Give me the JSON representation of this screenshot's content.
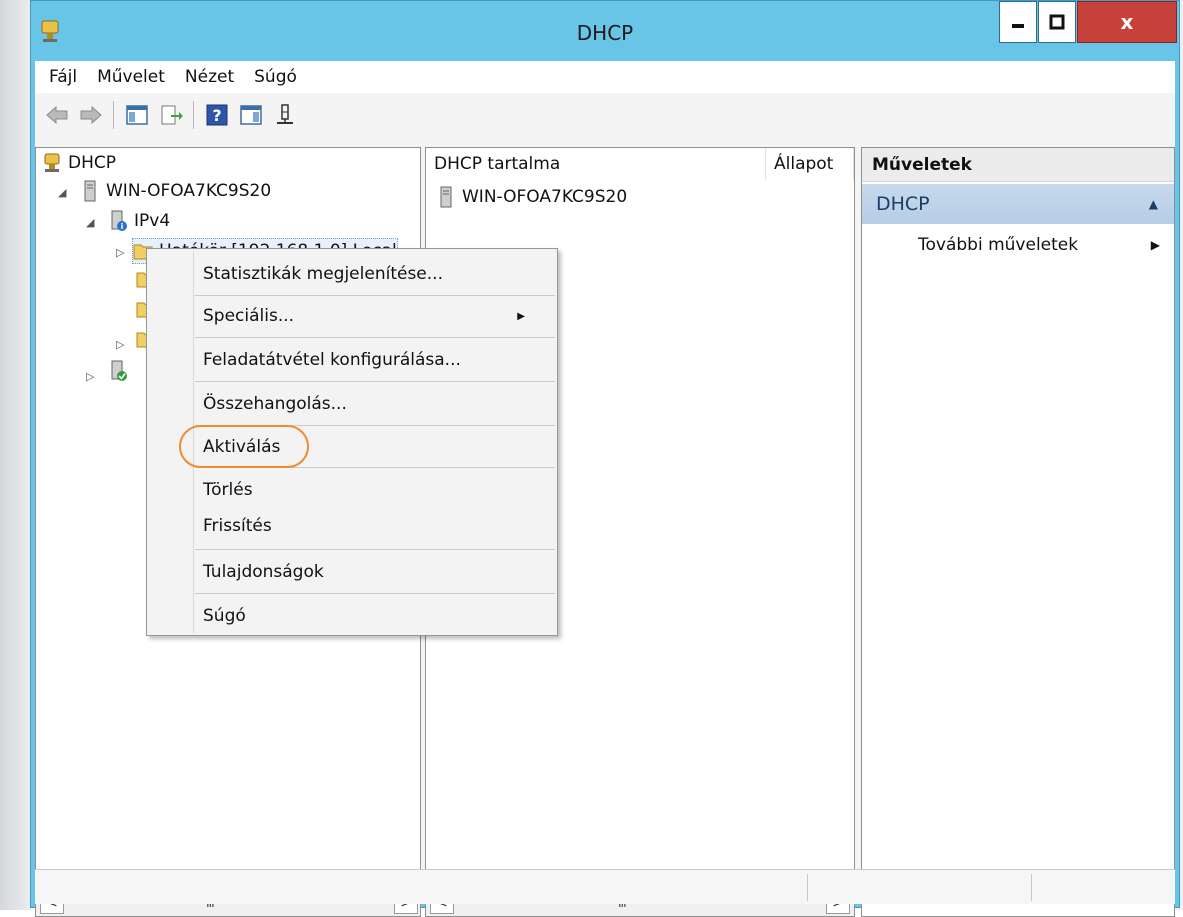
{
  "window": {
    "title": "DHCP",
    "close_label": "x",
    "accent": "#69c5e8"
  },
  "menubar": {
    "items": [
      "Fájl",
      "Művelet",
      "Nézet",
      "Súgó"
    ]
  },
  "toolbar": {
    "icons": [
      "back-arrow-icon",
      "forward-arrow-icon",
      "show-hide-tree-icon",
      "export-list-icon",
      "help-icon",
      "show-hide-action-pane-icon",
      "filter-icon"
    ]
  },
  "tree": {
    "root": "DHCP",
    "server": "WIN-OFOA7KC9S20",
    "ipv4": "IPv4",
    "scope_partial": "Hatókör [192.168.1.0] Local"
  },
  "content": {
    "columns": [
      "DHCP tartalma",
      "Állapot"
    ],
    "rows": [
      "WIN-OFOA7KC9S20"
    ]
  },
  "scrollbar": {
    "left": "<",
    "right": ">",
    "thumb": "III"
  },
  "actions": {
    "header": "Műveletek",
    "group": "DHCP",
    "item": "További műveletek"
  },
  "context_menu": {
    "items": [
      "Statisztikák megjelenítése...",
      "Speciális...",
      "Feladatátvétel konfigurálása...",
      "Összehangolás...",
      "Aktiválás",
      "Törlés",
      "Frissítés",
      "Tulajdonságok",
      "Súgó"
    ],
    "highlighted": "Aktiválás",
    "highlight_color": "#f28a2f"
  }
}
